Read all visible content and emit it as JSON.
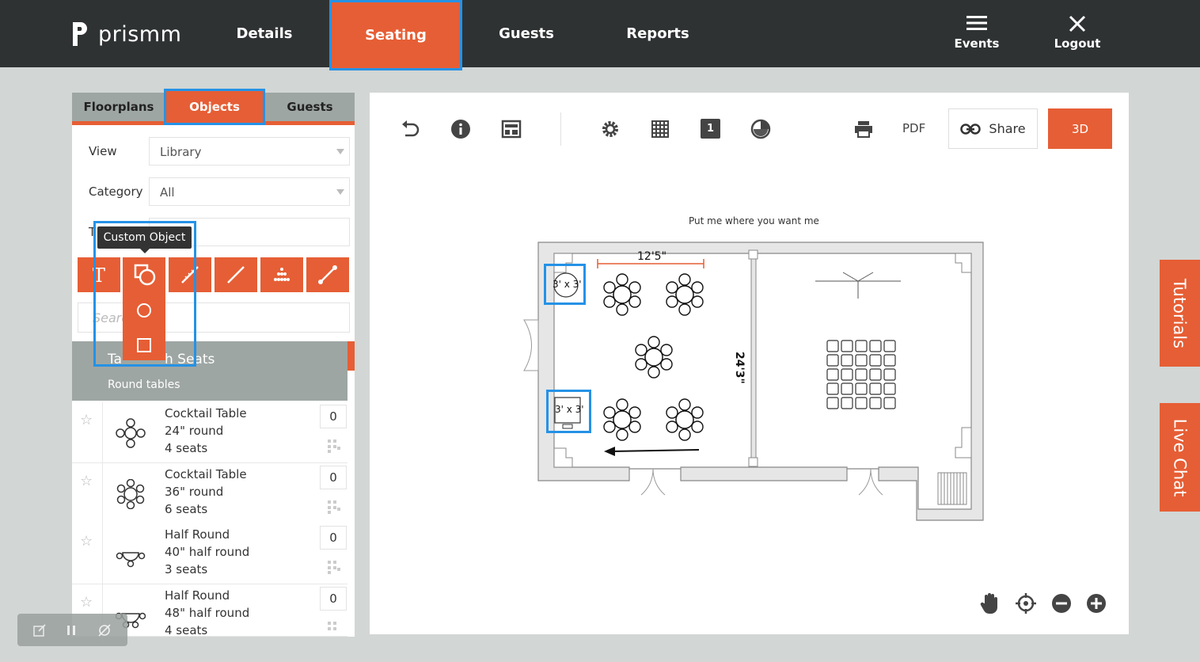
{
  "app": {
    "logo_text": "prismm"
  },
  "nav": {
    "details": "Details",
    "seating": "Seating",
    "guests": "Guests",
    "reports": "Reports",
    "events": "Events",
    "logout": "Logout"
  },
  "left_tabs": {
    "floorplans": "Floorplans",
    "objects": "Objects",
    "guests": "Guests"
  },
  "filters": {
    "view_label": "View",
    "view_value": "Library",
    "category_label": "Category",
    "category_value": "All",
    "third_label_partial": "T",
    "search_placeholder": "Search"
  },
  "tooltip": "Custom Object",
  "category_header": {
    "title_visible_start": "Ta",
    "title_visible_end": "h Seats",
    "subtitle": "Round tables"
  },
  "items": [
    {
      "name": "Cocktail Table",
      "size": "24\" round",
      "seats": "4 seats",
      "qty": "0"
    },
    {
      "name": "Cocktail Table",
      "size": "36\" round",
      "seats": "6 seats",
      "qty": "0"
    },
    {
      "name": "Half Round",
      "size": "40\" half round",
      "seats": "3 seats",
      "qty": "0"
    },
    {
      "name": "Half Round",
      "size": "48\" half round",
      "seats": "4 seats",
      "qty": "0"
    }
  ],
  "canvas": {
    "pdf": "PDF",
    "share": "Share",
    "three_d": "3D",
    "layer_number": "1",
    "hint": "Put me where you want me",
    "dim_width": "12'5\"",
    "dim_height": "24'3\"",
    "custom_obj_1": "3' x 3'",
    "custom_obj_2": "3' x 3'"
  },
  "side_tabs": {
    "tutorials": "Tutorials",
    "live_chat": "Live Chat"
  },
  "colors": {
    "accent": "#e65e35",
    "nav_bg": "#2f3233",
    "highlight": "#2592e6",
    "panel_grey": "#9ea6a3"
  }
}
